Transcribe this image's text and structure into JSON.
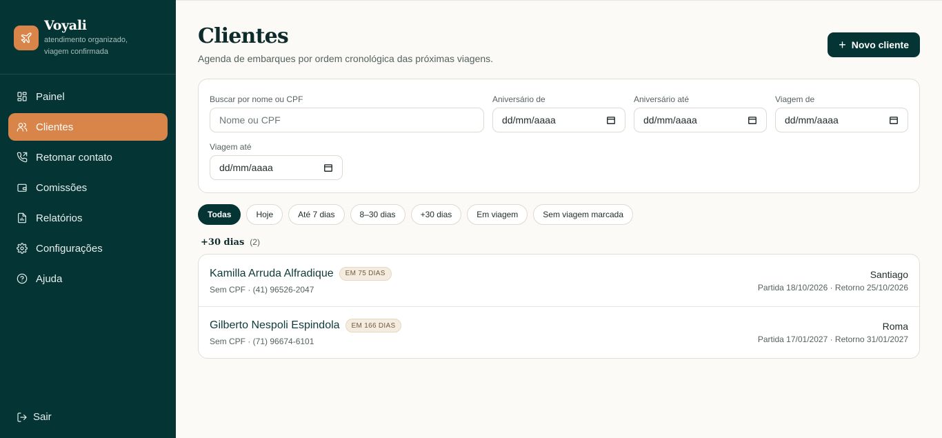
{
  "brand": {
    "name": "Voyali",
    "tagline_line1": "atendimento organizado,",
    "tagline_line2": "viagem confirmada",
    "icon": "plane-icon"
  },
  "nav": [
    {
      "label": "Painel",
      "icon": "dashboard-icon"
    },
    {
      "label": "Clientes",
      "icon": "users-icon",
      "active": true
    },
    {
      "label": "Retomar contato",
      "icon": "phone-icon"
    },
    {
      "label": "Comissões",
      "icon": "wallet-icon"
    },
    {
      "label": "Relatórios",
      "icon": "report-icon"
    },
    {
      "label": "Configurações",
      "icon": "gear-icon"
    },
    {
      "label": "Ajuda",
      "icon": "help-icon"
    }
  ],
  "logout": {
    "label": "Sair",
    "icon": "logout-icon"
  },
  "header": {
    "title": "Clientes",
    "subtitle": "Agenda de embarques por ordem cronológica das próximas viagens.",
    "new_button": "Novo cliente"
  },
  "filters": {
    "search": {
      "label": "Buscar por nome ou CPF",
      "placeholder": "Nome ou CPF"
    },
    "birthday_from": {
      "label": "Aniversário de",
      "value": "dd/mm/aaaa"
    },
    "birthday_to": {
      "label": "Aniversário até",
      "value": "dd/mm/aaaa"
    },
    "trip_from": {
      "label": "Viagem de",
      "value": "dd/mm/aaaa"
    },
    "trip_to": {
      "label": "Viagem até",
      "value": "dd/mm/aaaa"
    }
  },
  "chips": [
    "Todas",
    "Hoje",
    "Até 7 dias",
    "8–30 dias",
    "+30 dias",
    "Em viagem",
    "Sem viagem marcada"
  ],
  "active_chip": "Todas",
  "group": {
    "title": "+30 dias",
    "count": "(2)"
  },
  "clients": [
    {
      "name": "Kamilla Arruda Alfradique",
      "badge": "EM 75 DIAS",
      "meta": "Sem CPF · (41) 96526-2047",
      "destination": "Santiago",
      "dates": "Partida 18/10/2026 · Retorno 25/10/2026"
    },
    {
      "name": "Gilberto Nespoli Espindola",
      "badge": "EM 166 DIAS",
      "meta": "Sem CPF · (71) 96674-6101",
      "destination": "Roma",
      "dates": "Partida 17/01/2027 · Retorno 31/01/2027"
    }
  ],
  "colors": {
    "sidebar": "#043534",
    "accent": "#d98549",
    "primary": "#043534"
  }
}
